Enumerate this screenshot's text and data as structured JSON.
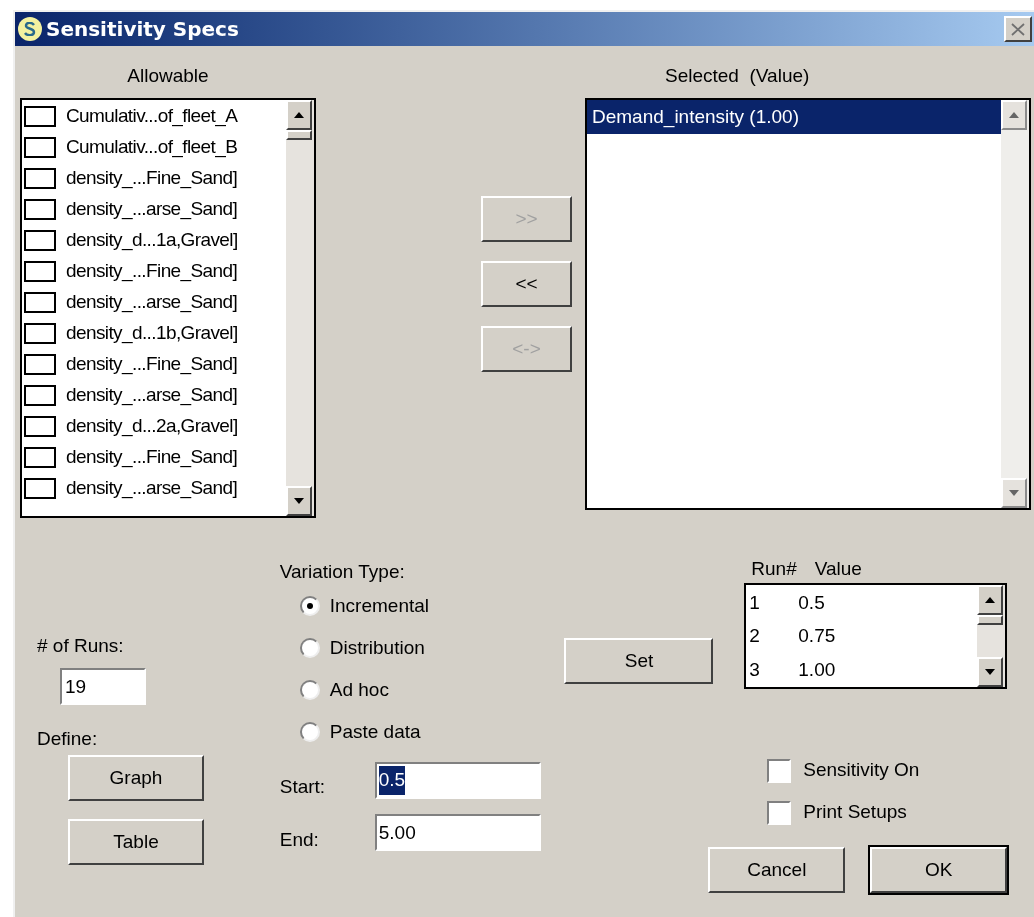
{
  "window": {
    "title": "Sensitivity Specs"
  },
  "allowable": {
    "label": "Allowable",
    "items": [
      {
        "label": "Cumulativ...of_fleet_A",
        "checked": false
      },
      {
        "label": "Cumulativ...of_fleet_B",
        "checked": false
      },
      {
        "label": "density_...Fine_Sand]",
        "checked": false
      },
      {
        "label": "density_...arse_Sand]",
        "checked": false
      },
      {
        "label": "density_d...1a,Gravel]",
        "checked": false
      },
      {
        "label": "density_...Fine_Sand]",
        "checked": false
      },
      {
        "label": "density_...arse_Sand]",
        "checked": false
      },
      {
        "label": "density_d...1b,Gravel]",
        "checked": false
      },
      {
        "label": "density_...Fine_Sand]",
        "checked": false
      },
      {
        "label": "density_...arse_Sand]",
        "checked": false
      },
      {
        "label": "density_d...2a,Gravel]",
        "checked": false
      },
      {
        "label": "density_...Fine_Sand]",
        "checked": false
      },
      {
        "label": "density_...arse_Sand]",
        "checked": false
      }
    ]
  },
  "transfer_buttons": [
    {
      "label": ">>",
      "disabled": true
    },
    {
      "label": "<<",
      "disabled": false
    },
    {
      "label": "<->",
      "disabled": true
    }
  ],
  "selected": {
    "label": "Selected  (Value)",
    "items": [
      {
        "label": "Demand_intensity (1.00)",
        "selected": true
      }
    ]
  },
  "runs": {
    "label": "# of Runs:",
    "value": "19"
  },
  "define": {
    "label": "Define:",
    "buttons": [
      "Graph",
      "Table"
    ]
  },
  "variation": {
    "label": "Variation Type:",
    "options": [
      {
        "label": "Incremental",
        "selected": true
      },
      {
        "label": "Distribution",
        "selected": false
      },
      {
        "label": "Ad hoc",
        "selected": false
      },
      {
        "label": "Paste data",
        "selected": false
      }
    ]
  },
  "range": [
    {
      "label": "Start:",
      "value": "0.5",
      "highlighted": true
    },
    {
      "label": "End:",
      "value": "5.00",
      "highlighted": false
    }
  ],
  "set_button": "Set",
  "run_table": {
    "columns": [
      "Run#",
      "Value"
    ],
    "rows": [
      [
        "1",
        "0.5"
      ],
      [
        "2",
        "0.75"
      ],
      [
        "3",
        "1.00"
      ]
    ]
  },
  "options": [
    {
      "label": "Sensitivity On",
      "checked": false
    },
    {
      "label": "Print Setups",
      "checked": false
    }
  ],
  "buttons": [
    {
      "label": "Cancel",
      "default": false
    },
    {
      "label": "OK",
      "default": true
    }
  ]
}
